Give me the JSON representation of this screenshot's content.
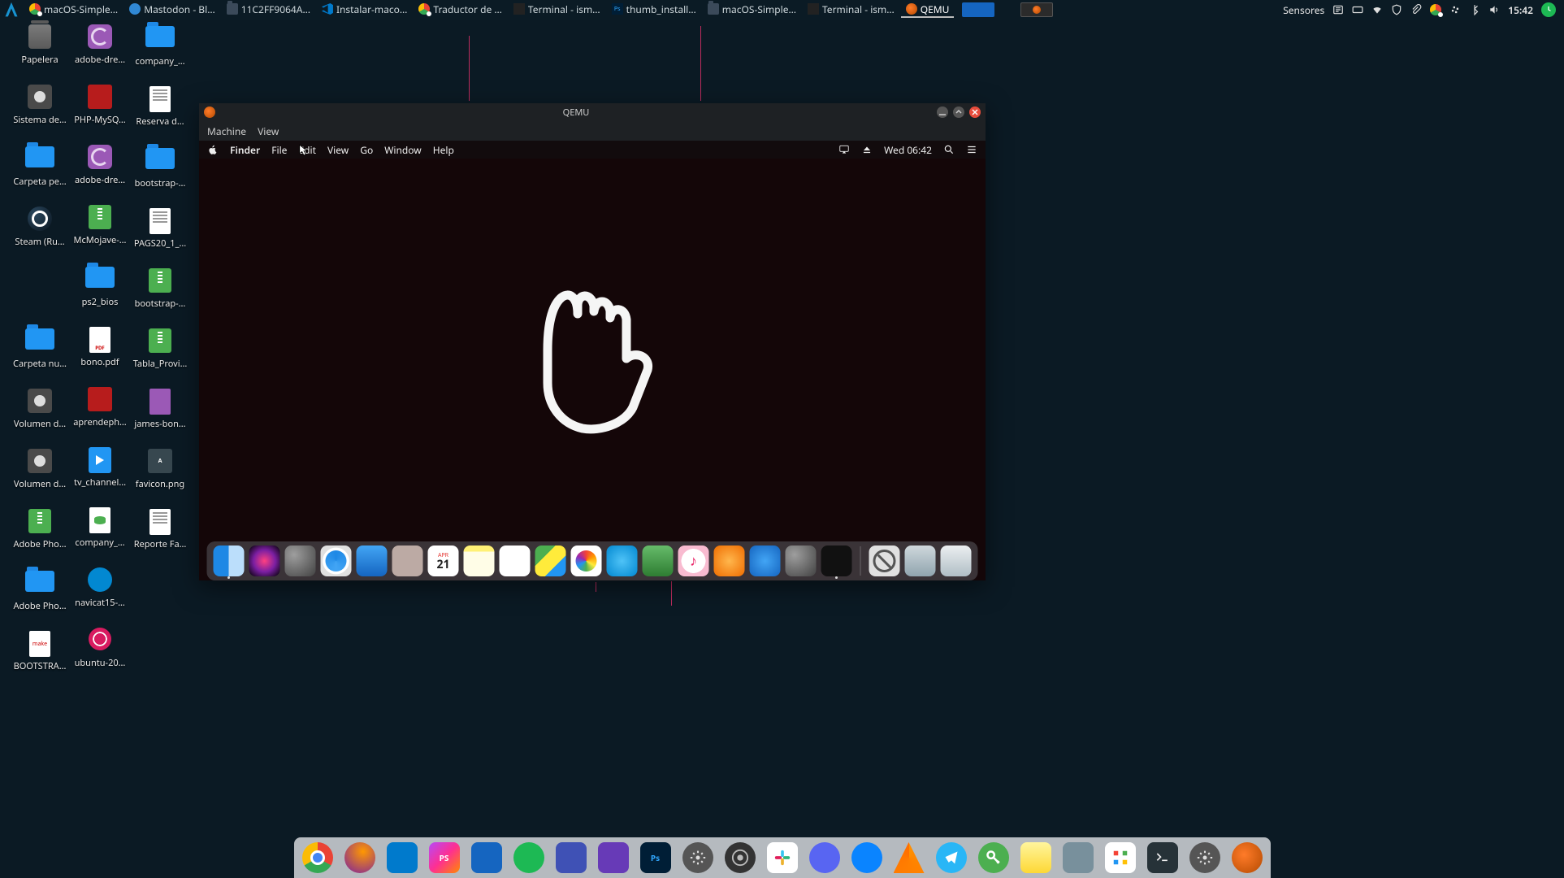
{
  "panel": {
    "tasks": [
      {
        "label": "macOS-Simple…",
        "icon": "chrome"
      },
      {
        "label": "Mastodon - Bl…",
        "icon": "mastodon"
      },
      {
        "label": "11C2FF9064A…",
        "icon": "folder"
      },
      {
        "label": "Instalar-maco…",
        "icon": "vscode"
      },
      {
        "label": "Traductor de …",
        "icon": "chrome"
      },
      {
        "label": "Terminal - ism…",
        "icon": "terminal"
      },
      {
        "label": "thumb_install…",
        "icon": "image"
      },
      {
        "label": "macOS-Simple…",
        "icon": "folder"
      },
      {
        "label": "Terminal - ism…",
        "icon": "terminal"
      },
      {
        "label": "QEMU",
        "icon": "qemu",
        "active": true
      }
    ],
    "tray": {
      "sensores_label": "Sensores",
      "clock": "15:42"
    }
  },
  "desktop": {
    "cols": [
      [
        {
          "label": "Papelera",
          "icon": "trash"
        },
        {
          "label": "Sistema de…",
          "icon": "disk"
        },
        {
          "label": "Carpeta pe…",
          "icon": "folder"
        },
        {
          "label": "Steam (Ru…",
          "icon": "steam"
        },
        {
          "label": "",
          "icon": ""
        },
        {
          "label": "Carpeta nu…",
          "icon": "folder"
        },
        {
          "label": "Volumen d…",
          "icon": "disk"
        },
        {
          "label": "Volumen d…",
          "icon": "disk"
        },
        {
          "label": "Adobe Pho…",
          "icon": "zip"
        },
        {
          "label": "Adobe Pho…",
          "icon": "folder"
        },
        {
          "label": "BOOTSTRA…",
          "icon": "code"
        }
      ],
      [
        {
          "label": "adobe-dre…",
          "icon": "dream"
        },
        {
          "label": "PHP-MySQ…",
          "icon": "img"
        },
        {
          "label": "adobe-dre…",
          "icon": "dream"
        },
        {
          "label": "McMojave-…",
          "icon": "zip"
        },
        {
          "label": "ps2_bios",
          "icon": "folder"
        },
        {
          "label": "bono.pdf",
          "icon": "pdf"
        },
        {
          "label": "aprendeph…",
          "icon": "img"
        },
        {
          "label": "tv_channel…",
          "icon": "video"
        },
        {
          "label": "company_…",
          "icon": "db"
        },
        {
          "label": "navicat15-…",
          "icon": "update"
        },
        {
          "label": "ubuntu-20…",
          "icon": "iso"
        }
      ],
      [
        {
          "label": "company_…",
          "icon": "folder"
        },
        {
          "label": "Reserva d…",
          "icon": "doc"
        },
        {
          "label": "bootstrap-…",
          "icon": "folder"
        },
        {
          "label": "PAGS20_1_…",
          "icon": "doc"
        },
        {
          "label": "bootstrap-…",
          "icon": "zip"
        },
        {
          "label": "Tabla_Provi…",
          "icon": "zip"
        },
        {
          "label": "james-bon…",
          "icon": "css"
        },
        {
          "label": "favicon.png",
          "icon": "png"
        },
        {
          "label": "Reporte Fa…",
          "icon": "doc"
        }
      ]
    ]
  },
  "qemu": {
    "title": "QEMU",
    "menu": {
      "machine": "Machine",
      "view": "View"
    }
  },
  "mac": {
    "menubar": {
      "app": "Finder",
      "items": [
        "File",
        "Edit",
        "View",
        "Go",
        "Window",
        "Help"
      ],
      "clock": "Wed 06:42"
    },
    "calendar": {
      "month": "APR",
      "day": "21"
    },
    "dock": [
      "finder",
      "siri",
      "launchpad",
      "safari",
      "mail",
      "contacts",
      "calendar",
      "notes",
      "reminders",
      "maps",
      "photos",
      "messages",
      "facetime",
      "music",
      "books",
      "appstore",
      "preferences",
      "terminal",
      "|",
      "blocked",
      "downloads",
      "trash"
    ]
  },
  "linux_dock": [
    "chrome",
    "firefox",
    "vscode",
    "phpstorm",
    "virtualbox",
    "spotify",
    "audio",
    "media",
    "photoshop",
    "settings-gear",
    "obs",
    "slack",
    "discord",
    "thunderbird",
    "vlc",
    "telegram",
    "keepass",
    "notes",
    "files",
    "grid",
    "terminal",
    "settings",
    "qemu"
  ]
}
